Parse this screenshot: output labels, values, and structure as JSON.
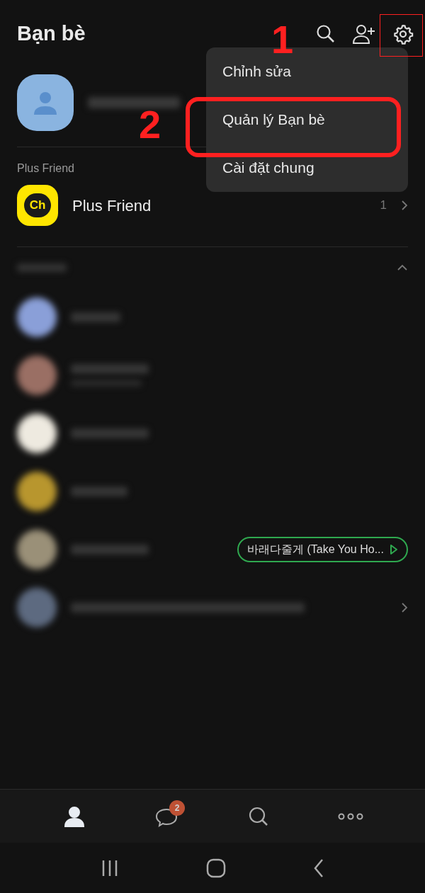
{
  "header": {
    "title": "Bạn bè"
  },
  "menu": {
    "items": [
      {
        "label": "Chỉnh sửa"
      },
      {
        "label": "Quản lý Bạn bè"
      },
      {
        "label": "Cài đặt chung"
      }
    ]
  },
  "annotations": [
    {
      "label": "1",
      "kind": "gear"
    },
    {
      "label": "2",
      "kind": "menu"
    }
  ],
  "plus_friend": {
    "section": "Plus Friend",
    "logo": "Ch",
    "name": "Plus Friend",
    "count": "1"
  },
  "friends": [
    {
      "kind": "plain"
    },
    {
      "kind": "two_line"
    },
    {
      "kind": "plain"
    },
    {
      "kind": "plain"
    },
    {
      "kind": "music",
      "music": "바래다줄게 (Take You Ho..."
    },
    {
      "kind": "more"
    }
  ],
  "bottom_nav": [
    {
      "kind": "friends",
      "selected": true
    },
    {
      "kind": "chats",
      "selected": false,
      "badge": "2"
    },
    {
      "kind": "search",
      "selected": false
    },
    {
      "kind": "more",
      "selected": false
    }
  ]
}
